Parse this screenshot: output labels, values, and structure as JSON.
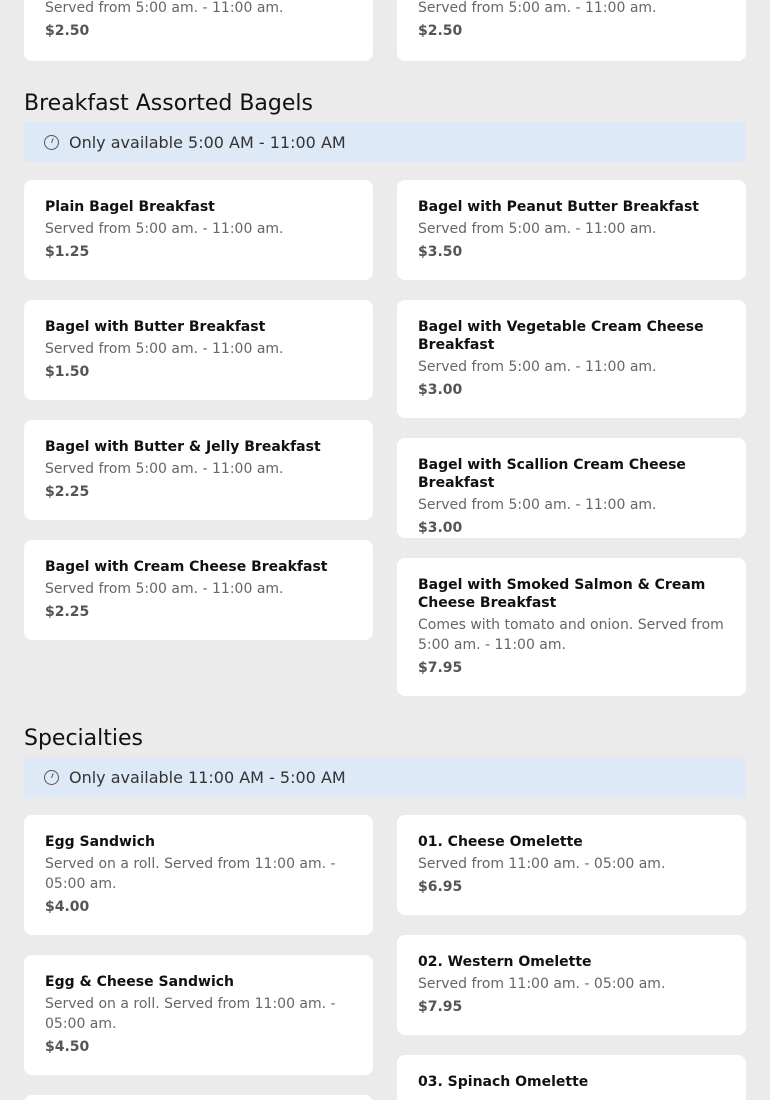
{
  "top_partial": {
    "left": {
      "desc": "Served from 5:00 am. - 11:00 am.",
      "price": "$2.50"
    },
    "right": {
      "desc": "Served from 5:00 am. - 11:00 am.",
      "price": "$2.50"
    }
  },
  "bagels": {
    "title": "Breakfast Assorted Bagels",
    "availability": "Only available 5:00 AM - 11:00 AM",
    "left_items": [
      {
        "name": "Plain Bagel Breakfast",
        "desc": "Served from 5:00 am. - 11:00 am.",
        "price": "$1.25"
      },
      {
        "name": "Bagel with Butter Breakfast",
        "desc": "Served from 5:00 am. - 11:00 am.",
        "price": "$1.50"
      },
      {
        "name": "Bagel with Butter & Jelly Breakfast",
        "desc": "Served from 5:00 am. - 11:00 am.",
        "price": "$2.25"
      },
      {
        "name": "Bagel with Cream Cheese Breakfast",
        "desc": "Served from 5:00 am. - 11:00 am.",
        "price": "$2.25"
      }
    ],
    "right_items": [
      {
        "name": "Bagel with Peanut Butter Breakfast",
        "desc": "Served from 5:00 am. - 11:00 am.",
        "price": "$3.50"
      },
      {
        "name": "Bagel with Vegetable Cream Cheese Breakfast",
        "desc": "Served from 5:00 am. - 11:00 am.",
        "price": "$3.00"
      },
      {
        "name": "Bagel with Scallion Cream Cheese Breakfast",
        "desc": "Served from 5:00 am. - 11:00 am.",
        "price": "$3.00"
      },
      {
        "name": "Bagel with Smoked Salmon & Cream Cheese Breakfast",
        "desc": "Comes with tomato and onion. Served from 5:00 am. - 11:00 am.",
        "price": "$7.95"
      }
    ]
  },
  "specialties": {
    "title": "Specialties",
    "availability": "Only available 11:00 AM - 5:00 AM",
    "left_items": [
      {
        "name": "Egg Sandwich",
        "desc": "Served on a roll. Served from 11:00 am. - 05:00 am.",
        "price": "$4.00"
      },
      {
        "name": "Egg & Cheese Sandwich",
        "desc": "Served on a roll. Served from 11:00 am. - 05:00 am.",
        "price": "$4.50"
      }
    ],
    "right_items": [
      {
        "name": "01. Cheese Omelette",
        "desc": "Served from 11:00 am. - 05:00 am.",
        "price": "$6.95"
      },
      {
        "name": "02. Western Omelette",
        "desc": "Served from 11:00 am. - 05:00 am.",
        "price": "$7.95"
      },
      {
        "name": "03. Spinach Omelette"
      }
    ]
  }
}
